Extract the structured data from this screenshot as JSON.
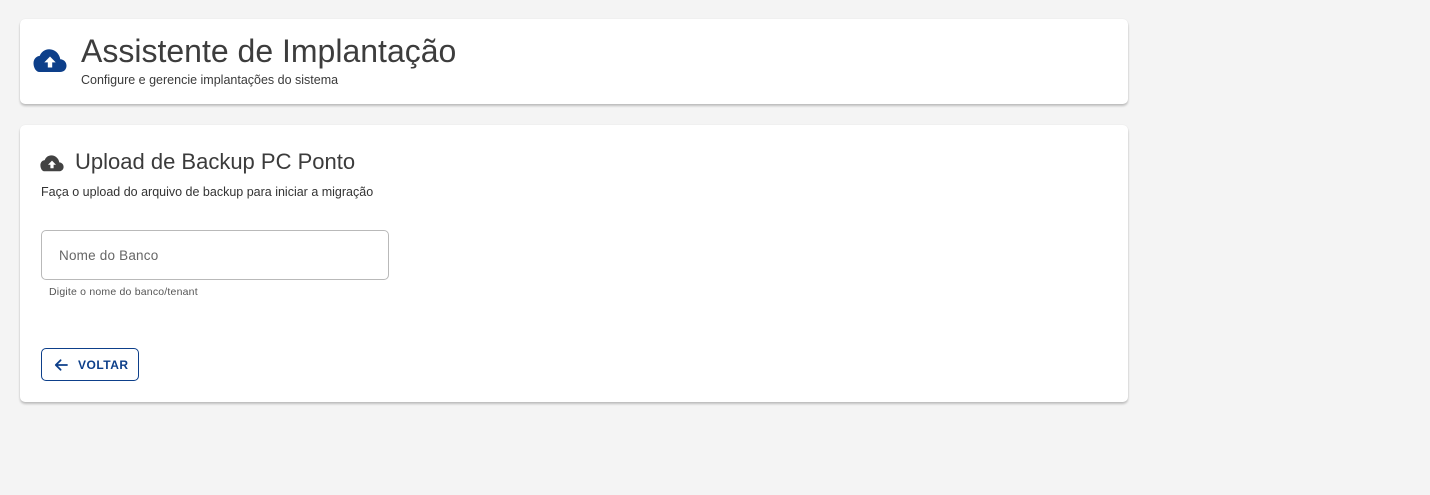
{
  "header": {
    "title": "Assistente de Implantação",
    "subtitle": "Configure e gerencie implantações do sistema",
    "icon": "cloud-upload-icon"
  },
  "upload_section": {
    "title": "Upload de Backup PC Ponto",
    "description": "Faça o upload do arquivo de backup para iniciar a migração",
    "icon": "cloud-upload-icon",
    "bank_field": {
      "placeholder": "Nome do Banco",
      "value": "",
      "hint": "Digite o nome do banco/tenant"
    },
    "back_button": {
      "label": "VOLTAR",
      "icon": "arrow-left-icon"
    }
  },
  "colors": {
    "accent": "#0d3f8a",
    "background": "#f4f4f4",
    "card": "#ffffff",
    "section_icon": "#424242"
  }
}
